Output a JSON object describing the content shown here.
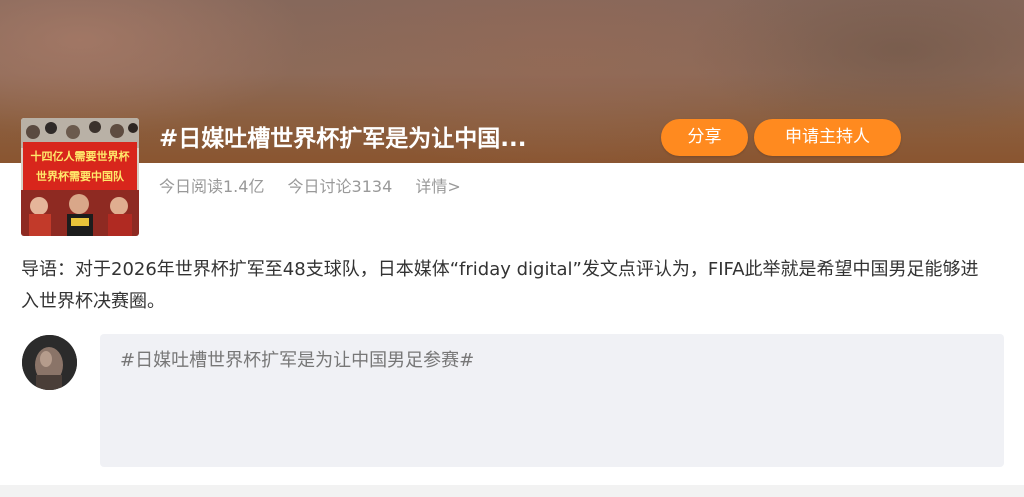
{
  "topic": {
    "title": "#日媒吐槽世界杯扩军是为让中国...",
    "banner_text": [
      "十四亿人需要世界杯",
      "世界杯需要中国队"
    ],
    "stats": {
      "reads": "今日阅读1.4亿",
      "discussions": "今日讨论3134",
      "detail": "详情>"
    }
  },
  "actions": {
    "share": "分享",
    "apply_host": "申请主持人"
  },
  "intro": {
    "text": "导语：对于2026年世界杯扩军至48支球队，日本媒体“friday digital”发文点评认为，FIFA此举就是希望中国男足能够进入世界杯决赛圈。"
  },
  "composer": {
    "value": "#日媒吐槽世界杯扩军是为让中国男足参赛#"
  },
  "colors": {
    "accent": "#ff8a1f",
    "text": "#333333",
    "muted": "#999999",
    "input_bg": "#f0f1f5"
  }
}
